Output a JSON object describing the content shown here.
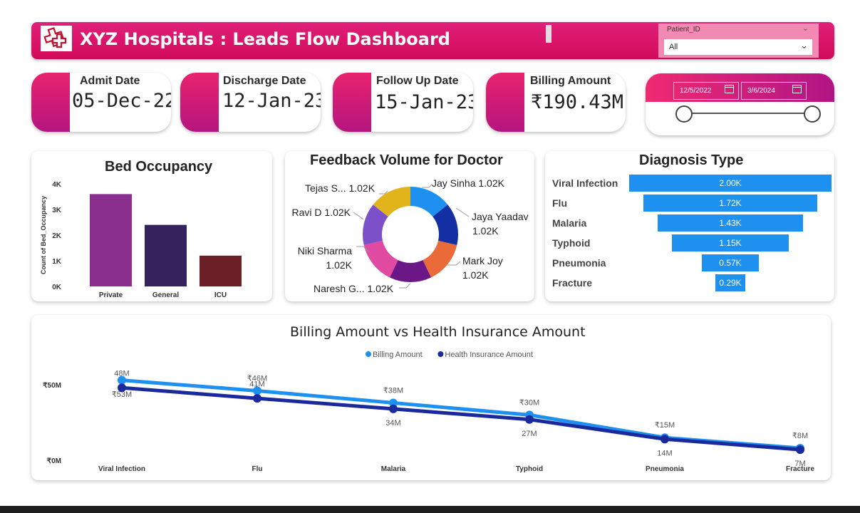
{
  "header": {
    "title": "XYZ Hospitals : Leads Flow Dashboard",
    "slicer_label": "Patient_ID",
    "slicer_value": "All"
  },
  "kpis": [
    {
      "label": "Admit Date",
      "value": "05-Dec-22"
    },
    {
      "label": "Discharge Date",
      "value": "12-Jan-23"
    },
    {
      "label": "Follow Up Date",
      "value": "15-Jan-23"
    },
    {
      "label": "Billing Amount",
      "value": "₹190.43M"
    }
  ],
  "date_range": {
    "start": "12/5/2022",
    "end": "3/6/2024"
  },
  "colors": {
    "accent": "#e0207a",
    "accent_dark": "#b5157f",
    "funnel": "#1e90f0",
    "billing": "#1e90f0",
    "insurance": "#1a2a9c"
  },
  "chart_data": [
    {
      "type": "bar",
      "title": "Bed Occupancy",
      "ylabel": "Count of Bed_Occupancy",
      "categories": [
        "Private",
        "General",
        "ICU"
      ],
      "values": [
        3600,
        2400,
        1200
      ],
      "colors": [
        "#8a2f8e",
        "#34235c",
        "#6b1f26"
      ],
      "ylim": [
        0,
        4000
      ],
      "yticks": [
        {
          "v": 0,
          "t": "0K"
        },
        {
          "v": 1000,
          "t": "1K"
        },
        {
          "v": 2000,
          "t": "2K"
        },
        {
          "v": 3000,
          "t": "3K"
        },
        {
          "v": 4000,
          "t": "4K"
        }
      ],
      "grid": false
    },
    {
      "type": "pie",
      "title": "Feedback Volume for Doctor",
      "donut": true,
      "slices": [
        {
          "name": "Jay Sinha",
          "value": 1.02,
          "label": "1.02K",
          "color": "#1e90f0"
        },
        {
          "name": "Jaya Yaadav",
          "value": 1.02,
          "label": "1.02K",
          "color": "#142ea3"
        },
        {
          "name": "Mark Joy",
          "value": 1.02,
          "label": "1.02K",
          "color": "#ea6a3a"
        },
        {
          "name": "Naresh G...",
          "value": 1.02,
          "label": "1.02K",
          "color": "#6b1787"
        },
        {
          "name": "Niki Sharma",
          "value": 1.02,
          "label": "1.02K",
          "color": "#e04aa0"
        },
        {
          "name": "Ravi D",
          "value": 1.02,
          "label": "1.02K",
          "color": "#7b50c8"
        },
        {
          "name": "Tejas S...",
          "value": 1.02,
          "label": "1.02K",
          "color": "#e0b41a"
        }
      ]
    },
    {
      "type": "bar",
      "orientation": "funnel",
      "title": "Diagnosis Type",
      "categories": [
        "Viral Infection",
        "Flu",
        "Malaria",
        "Typhoid",
        "Pneumonia",
        "Fracture"
      ],
      "values": [
        2000,
        1720,
        1430,
        1150,
        570,
        290
      ],
      "labels": [
        "2.00K",
        "1.72K",
        "1.43K",
        "1.15K",
        "0.57K",
        "0.29K"
      ]
    },
    {
      "type": "line",
      "title": "Billing Amount vs Health Insurance Amount",
      "categories": [
        "Viral Infection",
        "Flu",
        "Malaria",
        "Typhoid",
        "Pneumonia",
        "Fracture"
      ],
      "ylim": [
        0,
        50
      ],
      "yticks": [
        {
          "v": 0,
          "t": "₹0M"
        },
        {
          "v": 50,
          "t": "₹50M"
        }
      ],
      "legend_position": "top-center",
      "series": [
        {
          "name": "Billing Amount",
          "values": [
            53,
            46,
            38,
            30,
            15,
            8
          ],
          "labels": [
            "₹53M",
            "₹46M",
            "₹38M",
            "₹30M",
            "₹15M",
            "₹8M"
          ],
          "color": "#1e90f0"
        },
        {
          "name": "Health Insurance Amount",
          "values": [
            48,
            41,
            34,
            27,
            14,
            7
          ],
          "labels": [
            "48M",
            "41M",
            "34M",
            "27M",
            "14M",
            "7M"
          ],
          "color": "#1a2a9c"
        }
      ]
    }
  ]
}
